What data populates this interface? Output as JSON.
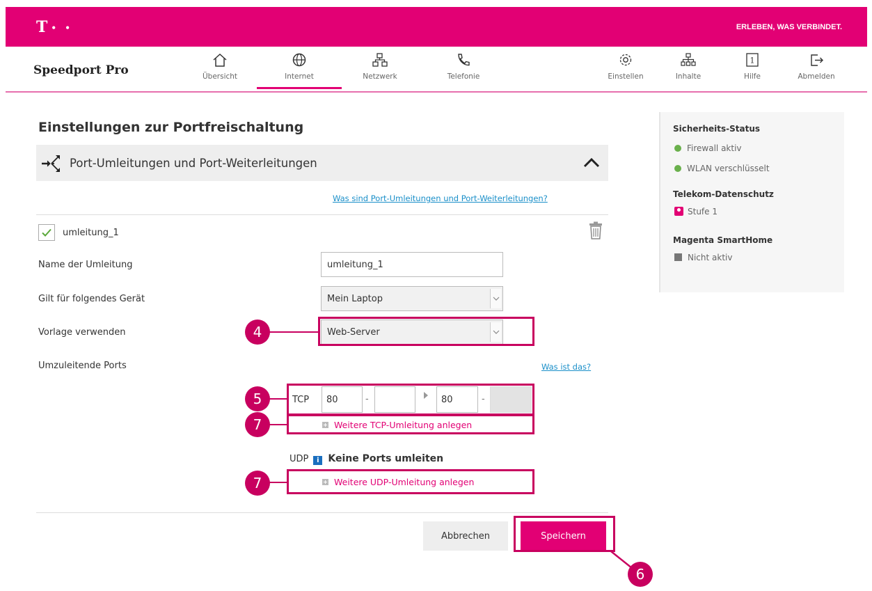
{
  "header": {
    "logo": "T",
    "logo_dots": "• •",
    "tagline": "ERLEBEN, WAS VERBINDET."
  },
  "nav": {
    "brand": "Speedport Pro",
    "items": [
      {
        "label": "Übersicht",
        "icon": "home-icon"
      },
      {
        "label": "Internet",
        "icon": "globe-icon",
        "active": true
      },
      {
        "label": "Netzwerk",
        "icon": "network-icon"
      },
      {
        "label": "Telefonie",
        "icon": "phone-icon"
      }
    ],
    "right_items": [
      {
        "label": "Einstellen",
        "icon": "gear-icon"
      },
      {
        "label": "Inhalte",
        "icon": "content-tree-icon"
      },
      {
        "label": "Hilfe",
        "icon": "help-icon",
        "icon_text": "1"
      },
      {
        "label": "Abmelden",
        "icon": "logout-icon"
      }
    ]
  },
  "main": {
    "page_title": "Einstellungen zur Portfreischaltung",
    "section_title": "Port-Umleitungen und Port-Weiterleitungen",
    "section_help_link": "Was sind Port-Umleitungen und Port-Weiterleitungen?",
    "rule": {
      "enabled": true,
      "title": "umleitung_1"
    },
    "fields": {
      "name_label": "Name der Umleitung",
      "name_value": "umleitung_1",
      "device_label": "Gilt für folgendes Gerät",
      "device_value": "Mein Laptop",
      "template_label": "Vorlage verwenden",
      "template_value": "Web-Server",
      "ports_label": "Umzuleitende Ports",
      "ports_help_link": "Was ist das?"
    },
    "tcp": {
      "label": "TCP",
      "from_start": "80",
      "from_end": "",
      "sep1": "-",
      "to_start": "80",
      "sep2": "-",
      "to_end": "",
      "add_link": "Weitere TCP-Umleitung anlegen"
    },
    "udp": {
      "label": "UDP",
      "info": "i",
      "status": "Keine Ports umleiten",
      "add_link": "Weitere UDP-Umleitung anlegen"
    },
    "buttons": {
      "cancel": "Abbrechen",
      "save": "Speichern"
    },
    "callouts": {
      "template": "4",
      "tcp": "5",
      "save": "6",
      "tcp_add": "7",
      "udp_add": "7"
    }
  },
  "sidebar": {
    "security_heading": "Sicherheits-Status",
    "firewall": "Firewall aktiv",
    "wlan": "WLAN verschlüsselt",
    "privacy_heading": "Telekom-Datenschutz",
    "privacy_level": "Stufe 1",
    "smarthome_heading": "Magenta SmartHome",
    "smarthome_status": "Nicht aktiv"
  },
  "colors": {
    "brand_magenta": "#e20074",
    "highlight": "#c8005f",
    "link_blue": "#1a8fc9",
    "status_green": "#6ab04c"
  }
}
